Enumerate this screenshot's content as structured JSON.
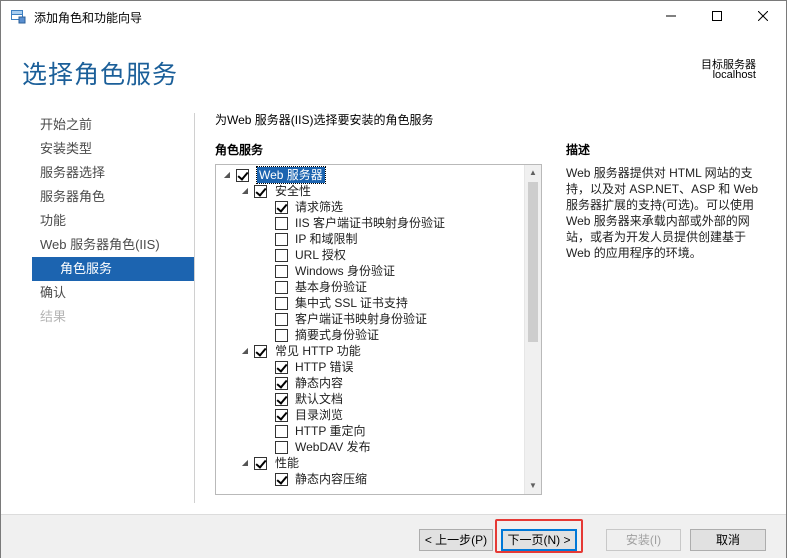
{
  "window": {
    "title": "添加角色和功能向导"
  },
  "header": {
    "page_title": "选择角色服务",
    "target_label": "目标服务器",
    "target_value": "localhost"
  },
  "nav": {
    "items": [
      {
        "label": "开始之前",
        "state": "normal",
        "sub": false
      },
      {
        "label": "安装类型",
        "state": "normal",
        "sub": false
      },
      {
        "label": "服务器选择",
        "state": "normal",
        "sub": false
      },
      {
        "label": "服务器角色",
        "state": "normal",
        "sub": false
      },
      {
        "label": "功能",
        "state": "normal",
        "sub": false
      },
      {
        "label": "Web 服务器角色(IIS)",
        "state": "normal",
        "sub": false
      },
      {
        "label": "角色服务",
        "state": "active",
        "sub": true
      },
      {
        "label": "确认",
        "state": "normal",
        "sub": false
      },
      {
        "label": "结果",
        "state": "disabled",
        "sub": false
      }
    ]
  },
  "main": {
    "intro": "为Web 服务器(IIS)选择要安装的角色服务",
    "roles_heading": "角色服务",
    "description_heading": "描述",
    "description_text": "Web 服务器提供对 HTML 网站的支持，以及对 ASP.NET、ASP 和 Web 服务器扩展的支持(可选)。可以使用 Web 服务器来承载内部或外部的网站，或者为开发人员提供创建基于 Web 的应用程序的环境。"
  },
  "tree": {
    "items": [
      {
        "label": "Web 服务器",
        "level": 0,
        "expanded": true,
        "checked": true,
        "selected": true
      },
      {
        "label": "安全性",
        "level": 1,
        "expanded": true,
        "checked": true,
        "selected": false
      },
      {
        "label": "请求筛选",
        "level": 2,
        "checked": true
      },
      {
        "label": "IIS 客户端证书映射身份验证",
        "level": 2,
        "checked": false
      },
      {
        "label": "IP 和域限制",
        "level": 2,
        "checked": false
      },
      {
        "label": "URL 授权",
        "level": 2,
        "checked": false
      },
      {
        "label": "Windows 身份验证",
        "level": 2,
        "checked": false
      },
      {
        "label": "基本身份验证",
        "level": 2,
        "checked": false
      },
      {
        "label": "集中式 SSL 证书支持",
        "level": 2,
        "checked": false
      },
      {
        "label": "客户端证书映射身份验证",
        "level": 2,
        "checked": false
      },
      {
        "label": "摘要式身份验证",
        "level": 2,
        "checked": false
      },
      {
        "label": "常见 HTTP 功能",
        "level": 1,
        "expanded": true,
        "checked": true
      },
      {
        "label": "HTTP 错误",
        "level": 2,
        "checked": true
      },
      {
        "label": "静态内容",
        "level": 2,
        "checked": true
      },
      {
        "label": "默认文档",
        "level": 2,
        "checked": true
      },
      {
        "label": "目录浏览",
        "level": 2,
        "checked": true
      },
      {
        "label": "HTTP 重定向",
        "level": 2,
        "checked": false
      },
      {
        "label": "WebDAV 发布",
        "level": 2,
        "checked": false
      },
      {
        "label": "性能",
        "level": 1,
        "expanded": true,
        "checked": true
      },
      {
        "label": "静态内容压缩",
        "level": 2,
        "checked": true
      }
    ]
  },
  "footer": {
    "prev_label": "< 上一步(P)",
    "next_label": "下一页(N) >",
    "install_label": "安装(I)",
    "cancel_label": "取消"
  },
  "colors": {
    "accent": "#1c64b0",
    "title": "#1b5f99",
    "highlight": "#e53935"
  }
}
